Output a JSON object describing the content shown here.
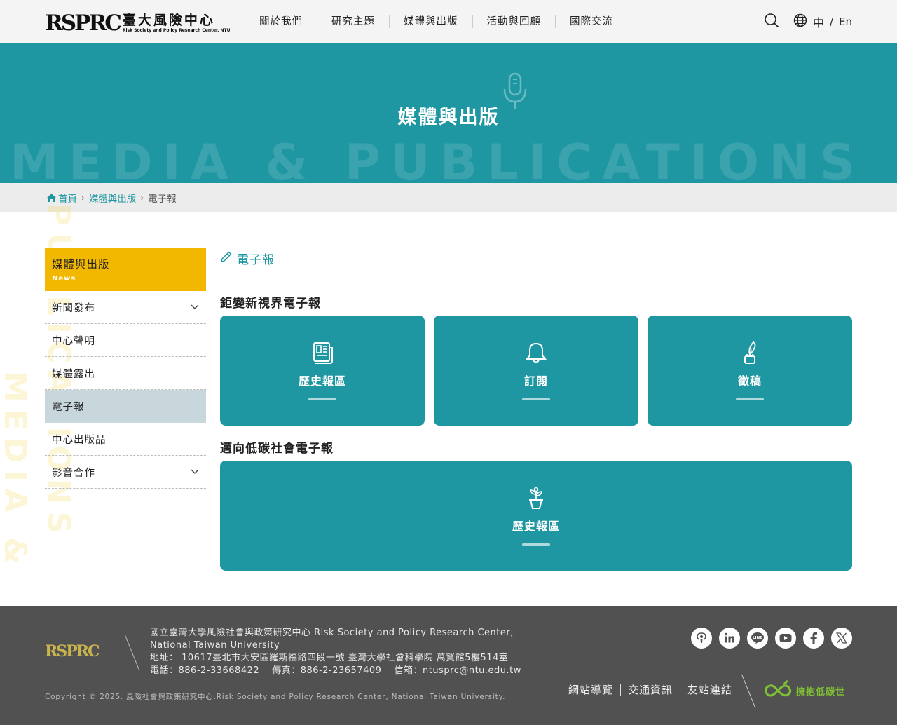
{
  "header": {
    "logo_mark": "RSPRC",
    "logo_cn": "臺大風險中心",
    "logo_en": "Risk Society and Policy Research Center, NTU",
    "nav": [
      "關於我們",
      "研究主題",
      "媒體與出版",
      "活動與回顧",
      "國際交流"
    ],
    "lang_zh": "中",
    "lang_sep": "/",
    "lang_en": "En"
  },
  "banner": {
    "title": "媒體與出版",
    "bg_text": "MEDIA & PUBLICATIONS"
  },
  "breadcrumb": {
    "home": "首頁",
    "parent": "媒體與出版",
    "current": "電子報"
  },
  "decor": {
    "vertical_a": "PUBLICATIONS",
    "vertical_b": "MEDIA &"
  },
  "sidebar": {
    "title": "媒體與出版",
    "subtitle": "News",
    "items": [
      {
        "label": "新聞發布",
        "has_sub": true
      },
      {
        "label": "中心聲明",
        "has_sub": false
      },
      {
        "label": "媒體露出",
        "has_sub": false
      },
      {
        "label": "電子報",
        "has_sub": false
      },
      {
        "label": "中心出版品",
        "has_sub": false
      },
      {
        "label": "影音合作",
        "has_sub": true
      }
    ]
  },
  "main": {
    "page_title": "電子報",
    "section1": {
      "title": "鉅變新視界電子報",
      "cards": [
        {
          "label": "歷史報區",
          "icon": "newspaper-icon"
        },
        {
          "label": "訂閱",
          "icon": "bell-icon"
        },
        {
          "label": "徵稿",
          "icon": "quill-icon"
        }
      ]
    },
    "section2": {
      "title": "邁向低碳社會電子報",
      "cards": [
        {
          "label": "歷史報區",
          "icon": "plant-icon"
        }
      ]
    }
  },
  "footer": {
    "logo": "RSPRC",
    "org_line1": "國立臺灣大學風險社會與政策研究中心 Risk Society and Policy Research Center,",
    "org_line2": "National Taiwan University",
    "address": "地址： 10617臺北市大安區羅斯福路四段一號 臺灣大學社會科學院 萬賢館5樓514室",
    "contact": "電話：886-2-33668422　 傳真：886-2-23657409　 信箱：ntusprc@ntu.edu.tw",
    "copyright": "Copyright © 2025. 風險社會與政策研究中心.Risk Society and Policy Research Center, National Taiwan University.",
    "links": [
      "網站導覽",
      "交通資訊",
      "友站連結"
    ],
    "green_badge": "擁抱低碳世",
    "social": [
      "podcast-icon",
      "linkedin-icon",
      "line-icon",
      "youtube-icon",
      "facebook-icon",
      "x-icon"
    ]
  },
  "colors": {
    "teal": "#1f97a2",
    "yellow": "#f2b800",
    "footer_bg": "#515151",
    "active_item": "#c7d7dc"
  }
}
